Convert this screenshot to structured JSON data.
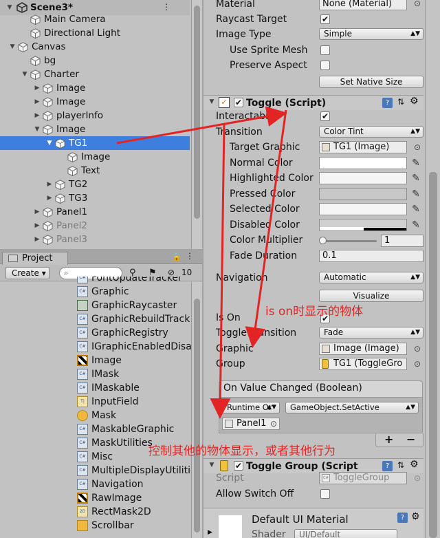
{
  "hierarchy": {
    "scene": "Scene3*",
    "rows": [
      {
        "label": "Main Camera",
        "depth": 2,
        "arrow": ""
      },
      {
        "label": "Directional Light",
        "depth": 2,
        "arrow": ""
      },
      {
        "label": "Canvas",
        "depth": 1,
        "arrow": "▼"
      },
      {
        "label": "bg",
        "depth": 2,
        "arrow": ""
      },
      {
        "label": "Charter",
        "depth": 2,
        "arrow": "▼"
      },
      {
        "label": "Image",
        "depth": 3,
        "arrow": "▶"
      },
      {
        "label": "Image",
        "depth": 3,
        "arrow": "▶"
      },
      {
        "label": "playerInfo",
        "depth": 3,
        "arrow": "▶"
      },
      {
        "label": "Image",
        "depth": 3,
        "arrow": "▼"
      },
      {
        "label": "TG1",
        "depth": 4,
        "arrow": "▼"
      },
      {
        "label": "Image",
        "depth": 5,
        "arrow": ""
      },
      {
        "label": "Text",
        "depth": 5,
        "arrow": ""
      },
      {
        "label": "TG2",
        "depth": 4,
        "arrow": "▶"
      },
      {
        "label": "TG3",
        "depth": 4,
        "arrow": "▶"
      },
      {
        "label": "Panel1",
        "depth": 3,
        "arrow": "▶"
      },
      {
        "label": "Panel2",
        "depth": 3,
        "arrow": "▶"
      },
      {
        "label": "Panel3",
        "depth": 3,
        "arrow": "▶"
      }
    ]
  },
  "project": {
    "tab": "Project",
    "create": "Create ▾",
    "count": "10",
    "items": [
      {
        "label": "FontUpdateTracker",
        "icon": "cs-script-icon"
      },
      {
        "label": "Graphic",
        "icon": "cs-script-icon"
      },
      {
        "label": "GraphicRaycaster",
        "icon": "raycaster-icon"
      },
      {
        "label": "GraphicRebuildTrack",
        "icon": "cs-script-icon"
      },
      {
        "label": "GraphicRegistry",
        "icon": "cs-script-icon"
      },
      {
        "label": "IGraphicEnabledDisa",
        "icon": "cs-script-icon"
      },
      {
        "label": "Image",
        "icon": "image-icon"
      },
      {
        "label": "IMask",
        "icon": "cs-script-icon"
      },
      {
        "label": "IMaskable",
        "icon": "cs-script-icon"
      },
      {
        "label": "InputField",
        "icon": "inputfield-icon"
      },
      {
        "label": "Mask",
        "icon": "mask-icon"
      },
      {
        "label": "MaskableGraphic",
        "icon": "cs-script-icon"
      },
      {
        "label": "MaskUtilities",
        "icon": "cs-script-icon"
      },
      {
        "label": "Misc",
        "icon": "cs-script-icon"
      },
      {
        "label": "MultipleDisplayUtilitie",
        "icon": "cs-script-icon"
      },
      {
        "label": "Navigation",
        "icon": "cs-script-icon"
      },
      {
        "label": "RawImage",
        "icon": "image-icon"
      },
      {
        "label": "RectMask2D",
        "icon": "rectmask2d-icon"
      },
      {
        "label": "Scrollbar",
        "icon": "scrollbar-icon"
      }
    ]
  },
  "inspector": {
    "material_label": "Material",
    "material_value": "None (Material)",
    "raycast_label": "Raycast Target",
    "image_type_label": "Image Type",
    "image_type_value": "Simple",
    "use_sprite_mesh": "Use Sprite Mesh",
    "preserve_aspect": "Preserve Aspect",
    "set_native_size": "Set Native Size",
    "toggle_title": "Toggle (Script)",
    "interactable": "Interactable",
    "transition_label": "Transition",
    "transition_value": "Color Tint",
    "target_graphic_label": "Target Graphic",
    "target_graphic_value": "TG1 (Image)",
    "normal_color": "Normal Color",
    "highlighted_color": "Highlighted Color",
    "pressed_color": "Pressed Color",
    "selected_color": "Selected Color",
    "disabled_color": "Disabled Color",
    "color_multiplier": "Color Multiplier",
    "color_multiplier_value": "1",
    "fade_duration": "Fade Duration",
    "fade_duration_value": "0.1",
    "navigation_label": "Navigation",
    "navigation_value": "Automatic",
    "visualize": "Visualize",
    "is_on": "Is On",
    "toggle_transition_label": "Toggle Transition",
    "toggle_transition_value": "Fade",
    "graphic_label": "Graphic",
    "graphic_value": "Image (Image)",
    "group_label": "Group",
    "group_value": "TG1 (ToggleGro",
    "event_title": "On Value Changed (Boolean)",
    "runtime": "Runtime Or",
    "function": "GameObject.SetActive",
    "object_value": "Panel1",
    "plus": "+",
    "minus": "−",
    "toggle_group_title": "Toggle Group (Script",
    "script_label": "Script",
    "script_value": "ToggleGroup",
    "allow_switch_off": "Allow Switch Off",
    "material_name": "Default UI Material",
    "shader_label": "Shader",
    "shader_value": "UI/Default"
  },
  "annotations": {
    "is_on_note": "is on时显示的物体",
    "event_note": "控制其他的物体显示，或者其他行为"
  },
  "colors": {
    "selection": "#3e7ede",
    "annotation": "#e32424"
  }
}
